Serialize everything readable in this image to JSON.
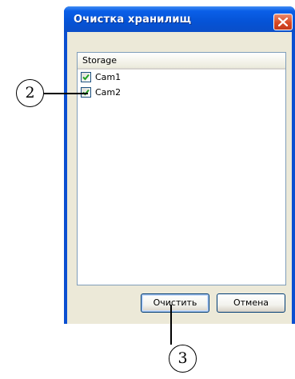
{
  "window": {
    "title": "Очистка хранилищ",
    "close_icon": "close-x-icon",
    "titlebar_color": "#0553d6",
    "close_color": "#d84923"
  },
  "listview": {
    "column_header": "Storage",
    "items": [
      {
        "label": "Cam1",
        "checked": true
      },
      {
        "label": "Cam2",
        "checked": true
      }
    ]
  },
  "buttons": {
    "clean_label": "Очистить",
    "cancel_label": "Отмена"
  },
  "callouts": {
    "marker_2": "2",
    "marker_3": "3"
  }
}
